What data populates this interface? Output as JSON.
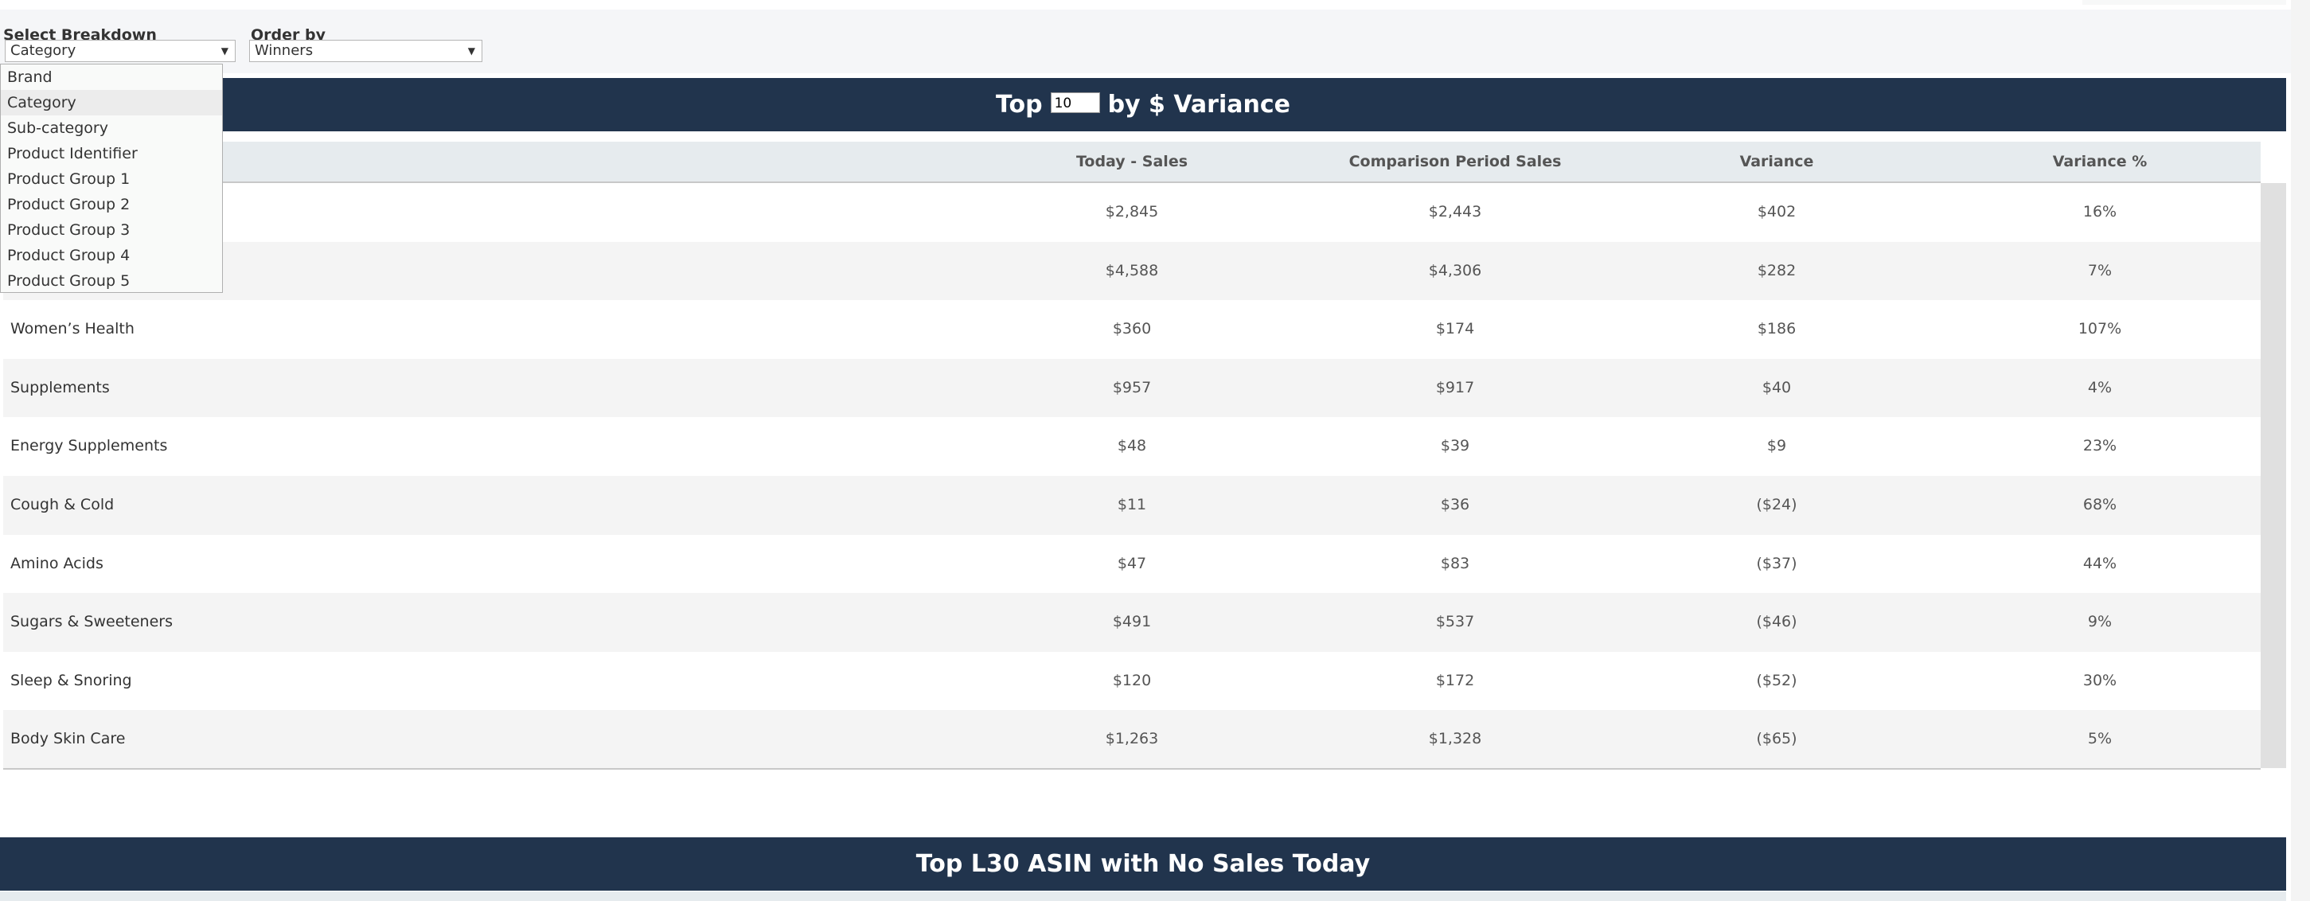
{
  "filters": {
    "breakdown": {
      "label": "Select Breakdown",
      "value": "Category",
      "options": [
        "Brand",
        "Category",
        "Sub-category",
        "Product Identifier",
        "Product Group 1",
        "Product Group 2",
        "Product Group 3",
        "Product Group 4",
        "Product Group 5"
      ],
      "selected_index": 1
    },
    "order_by": {
      "label": "Order by",
      "value": "Winners"
    }
  },
  "section_title": {
    "prefix": "Top",
    "top_n": "10",
    "suffix": "by $ Variance"
  },
  "table": {
    "columns": [
      "",
      "Today - Sales",
      "Comparison Period Sales",
      "Variance",
      "Variance %"
    ],
    "rows": [
      {
        "label": "",
        "today": "$2,845",
        "comparison": "$2,443",
        "variance": "$402",
        "variance_pct": "16%"
      },
      {
        "label": "",
        "today": "$4,588",
        "comparison": "$4,306",
        "variance": "$282",
        "variance_pct": "7%"
      },
      {
        "label": "Women’s Health",
        "today": "$360",
        "comparison": "$174",
        "variance": "$186",
        "variance_pct": "107%"
      },
      {
        "label": "Supplements",
        "today": "$957",
        "comparison": "$917",
        "variance": "$40",
        "variance_pct": "4%"
      },
      {
        "label": "Energy Supplements",
        "today": "$48",
        "comparison": "$39",
        "variance": "$9",
        "variance_pct": "23%"
      },
      {
        "label": "Cough & Cold",
        "today": "$11",
        "comparison": "$36",
        "variance": "($24)",
        "variance_pct": "68%"
      },
      {
        "label": "Amino Acids",
        "today": "$47",
        "comparison": "$83",
        "variance": "($37)",
        "variance_pct": "44%"
      },
      {
        "label": "Sugars & Sweeteners",
        "today": "$491",
        "comparison": "$537",
        "variance": "($46)",
        "variance_pct": "9%"
      },
      {
        "label": "Sleep & Snoring",
        "today": "$120",
        "comparison": "$172",
        "variance": "($52)",
        "variance_pct": "30%"
      },
      {
        "label": "Body Skin Care",
        "today": "$1,263",
        "comparison": "$1,328",
        "variance": "($65)",
        "variance_pct": "5%"
      }
    ]
  },
  "second_section": {
    "title": "Top L30 ASIN with No Sales Today"
  },
  "colors": {
    "header_band": "#21344d",
    "table_header_bg": "#e6ebee",
    "row_alt_bg": "#f4f4f4",
    "filter_panel_bg": "#f5f6f8"
  },
  "icons": {
    "dropdown_arrow": "▼"
  }
}
